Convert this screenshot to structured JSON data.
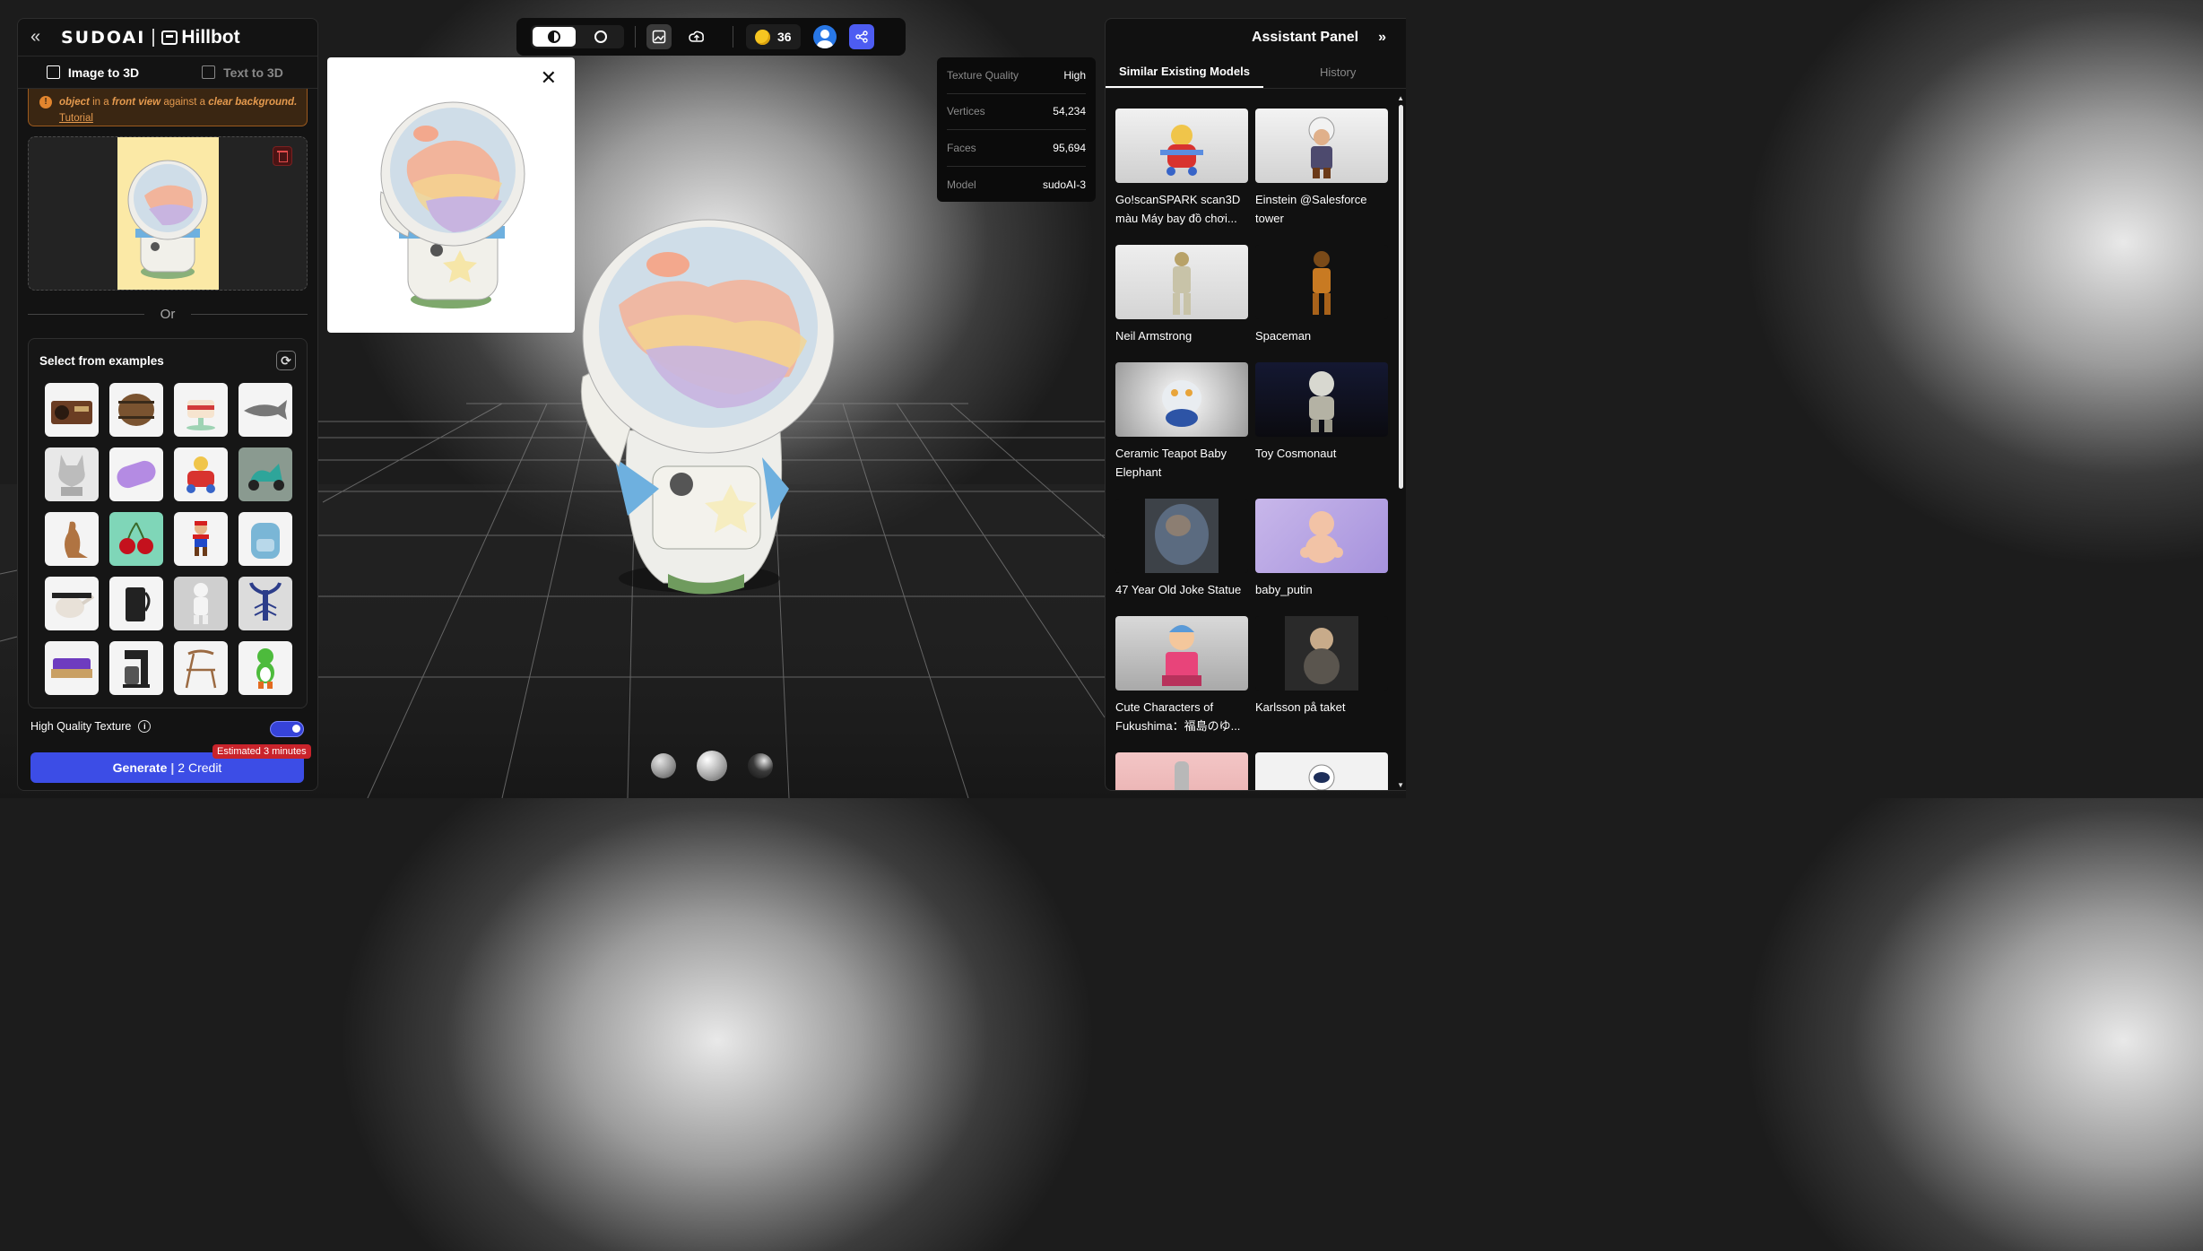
{
  "left_panel": {
    "brand_sudo": "SUDOAI",
    "brand_hill": "Hillbot",
    "tabs": [
      {
        "label": "Image to 3D",
        "active": true
      },
      {
        "label": "Text to 3D",
        "active": false
      }
    ],
    "notice": {
      "emph_1": "object",
      "text_1": " in a ",
      "emph_2": "front view",
      "text_2": " against a ",
      "emph_3": "clear background.",
      "link": "Tutorial"
    },
    "or_label": "Or",
    "examples": {
      "title": "Select from examples",
      "items": [
        "radio",
        "barrel",
        "cake",
        "shark",
        "wolf-bust",
        "pattern-tube",
        "toy-plane",
        "scooter",
        "kangaroo",
        "cherries",
        "mario",
        "backpack",
        "teapot",
        "kettle",
        "astronaut-figure",
        "lobster",
        "sofa",
        "coffee-maker",
        "chair",
        "yoshi"
      ]
    },
    "hq_label": "High Quality Texture",
    "hq_enabled": true,
    "estimate": "Estimated 3 minutes",
    "generate_label": "Generate",
    "generate_separator": "|",
    "generate_credit": "2 Credit"
  },
  "toolbar": {
    "credits": "36",
    "coin_color": "#f6c521",
    "share_color": "#4d5cf2"
  },
  "stats": [
    {
      "key": "Texture Quality",
      "value": "High"
    },
    {
      "key": "Vertices",
      "value": "54,234"
    },
    {
      "key": "Faces",
      "value": "95,694"
    },
    {
      "key": "Model",
      "value": "sudoAI-3"
    }
  ],
  "right_panel": {
    "title": "Assistant Panel",
    "tabs": [
      {
        "label": "Similar Existing Models",
        "active": true
      },
      {
        "label": "History",
        "active": false
      }
    ],
    "models": [
      {
        "name": "Go!scanSPARK scan3D màu Máy bay đồ chơi..."
      },
      {
        "name": "Einstein @Salesforce tower"
      },
      {
        "name": "Neil Armstrong"
      },
      {
        "name": "Spaceman"
      },
      {
        "name": "Ceramic Teapot Baby Elephant"
      },
      {
        "name": "Toy Cosmonaut"
      },
      {
        "name": "47 Year Old Joke Statue"
      },
      {
        "name": "baby_putin"
      },
      {
        "name": "Cute Characters of Fukushima：福島のゆ..."
      },
      {
        "name": "Karlsson på taket"
      },
      {
        "name": ""
      },
      {
        "name": ""
      }
    ]
  },
  "colors": {
    "accent": "#3c4de6",
    "warning": "#e59a4e",
    "danger": "#c9232b"
  }
}
